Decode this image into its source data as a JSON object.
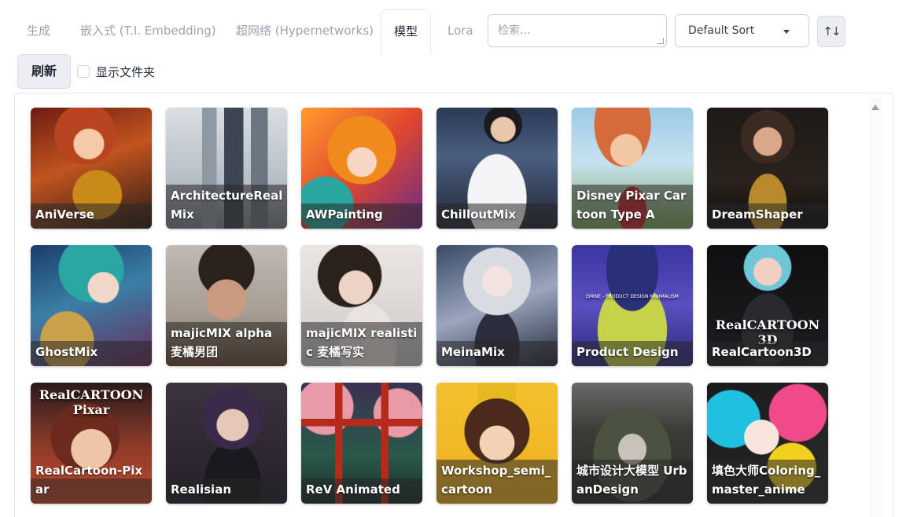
{
  "tabs": [
    {
      "label": "生成",
      "active": false
    },
    {
      "label": "嵌入式 (T.I. Embedding)",
      "active": false
    },
    {
      "label": "超网络 (Hypernetworks)",
      "active": false
    },
    {
      "label": "模型",
      "active": true
    },
    {
      "label": "Lora",
      "active": false
    }
  ],
  "search": {
    "placeholder": "检索..."
  },
  "sort": {
    "selected": "Default Sort",
    "direction_icon": "sort-direction-icon"
  },
  "refresh_label": "刷新",
  "show_folders_label": "显示文件夹",
  "models": [
    {
      "name": "AniVerse"
    },
    {
      "name": "ArchitectureRealMix"
    },
    {
      "name": "AWPainting"
    },
    {
      "name": "ChilloutMix"
    },
    {
      "name": "Disney Pixar Cartoon Type A"
    },
    {
      "name": "DreamShaper"
    },
    {
      "name": "GhostMix"
    },
    {
      "name": "majicMIX alpha 麦橘男团"
    },
    {
      "name": "majicMIX realistic 麦橘写实"
    },
    {
      "name": "MeinaMix"
    },
    {
      "name": "Product Design",
      "art_text": "EMINE - PRODUCT DESIGN MINIMALISM"
    },
    {
      "name": "RealCartoon3D",
      "art_text": "RealCARTOON 3D"
    },
    {
      "name": "RealCartoon-Pixar",
      "art_text": "RealCARTOON Pixar"
    },
    {
      "name": "Realisian"
    },
    {
      "name": "ReV Animated"
    },
    {
      "name": "Workshop_semi_cartoon"
    },
    {
      "name": "城市设计大模型 UrbanDesign"
    },
    {
      "name": "填色大师Coloring_master_anime"
    }
  ]
}
